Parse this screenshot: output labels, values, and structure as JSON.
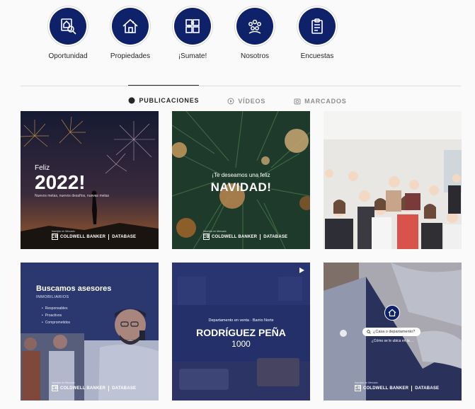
{
  "highlights": [
    {
      "label": "Oportunidad",
      "icon": "house-search-icon"
    },
    {
      "label": "Propiedades",
      "icon": "house-icon"
    },
    {
      "label": "¡Sumate!",
      "icon": "puzzle-icon"
    },
    {
      "label": "Nosotros",
      "icon": "team-icon"
    },
    {
      "label": "Encuestas",
      "icon": "clipboard-icon"
    }
  ],
  "tabs": {
    "posts": "PUBLICACIONES",
    "videos": "VÍDEOS",
    "tagged": "MARCADOS"
  },
  "brand": {
    "name": "COLDWELL BANKER",
    "office": "DATABASE",
    "tag": "Inscripto en Mercado"
  },
  "posts": {
    "p1": {
      "feliz": "Feliz",
      "year": "2022!",
      "sub": "Nuevos metas, nuevos desafíos, nuevas metas"
    },
    "p2": {
      "small": "¡Te deseamos una feliz",
      "big": "NAVIDAD!"
    },
    "p4": {
      "title": "Buscamos asesores",
      "sub": "INMOBILIARIOS",
      "items": [
        "Responsables",
        "Proactivos",
        "Comprometidos"
      ]
    },
    "p5": {
      "small": "Departamento en venta · Barrio Norte",
      "big": "RODRÍGUEZ PEÑA",
      "num": "1000"
    },
    "p6": {
      "search": "¿Casa o departamento?",
      "caption": "¿Cómo se le ubica en la ..."
    }
  },
  "colors": {
    "brand_navy": "#0f2168"
  }
}
